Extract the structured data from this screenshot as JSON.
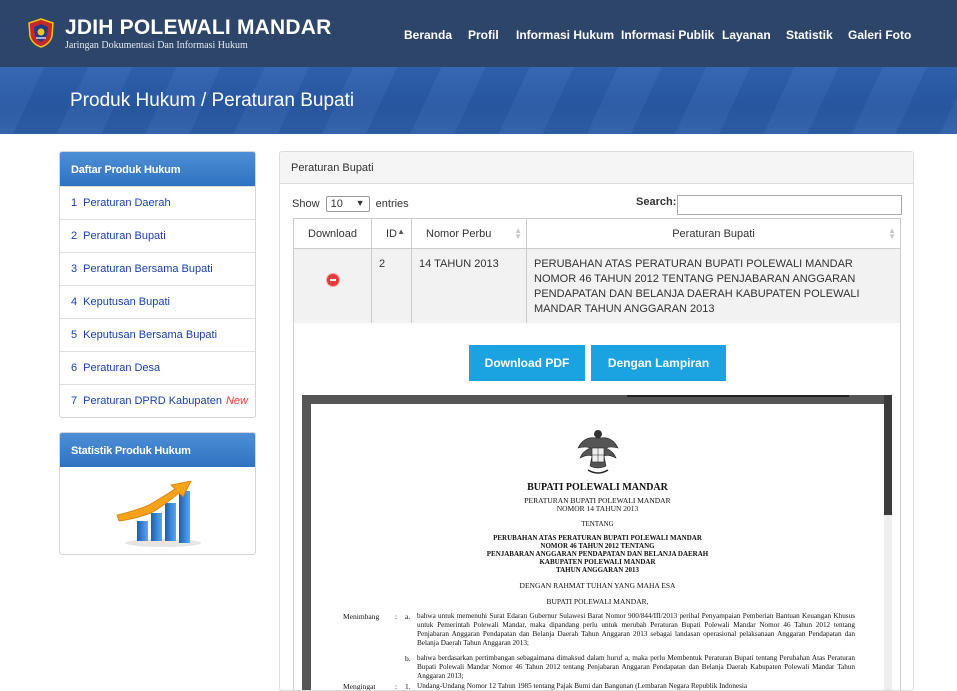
{
  "brand": {
    "title": "JDIH POLEWALI MANDAR",
    "subtitle": "Jaringan Dokumentasi Dan Informasi Hukum",
    "logo_icon": "regency-crest-icon"
  },
  "nav": [
    "Beranda",
    "Profil",
    "Informasi Hukum",
    "Informasi Publik",
    "Layanan",
    "Statistik",
    "Galeri Foto"
  ],
  "banner": {
    "title": "Produk Hukum / Peraturan Bupati"
  },
  "sidebar": {
    "panel_title": "Daftar Produk Hukum",
    "items": [
      {
        "num": "1",
        "label": "Peraturan Daerah",
        "badge": ""
      },
      {
        "num": "2",
        "label": "Peraturan Bupati",
        "badge": ""
      },
      {
        "num": "3",
        "label": "Peraturan Bersama Bupati",
        "badge": ""
      },
      {
        "num": "4",
        "label": "Keputusan Bupati",
        "badge": ""
      },
      {
        "num": "5",
        "label": "Keputusan Bersama Bupati",
        "badge": ""
      },
      {
        "num": "6",
        "label": "Peraturan Desa",
        "badge": ""
      },
      {
        "num": "7",
        "label": "Peraturan DPRD Kabupaten",
        "badge": "New"
      }
    ],
    "stats_title": "Statistik Produk Hukum",
    "stats_icon": "bar-chart-growth-icon"
  },
  "main": {
    "panel_title": "Peraturan Bupati",
    "show_label": "Show",
    "show_value": "10",
    "entries_label": "entries",
    "search_label": "Search:",
    "search_value": "",
    "columns": [
      "Download",
      "ID",
      "Nomor Perbu",
      "Peraturan Bupati"
    ],
    "rows": [
      {
        "download_icon": "minus-circle-icon",
        "id": "2",
        "nomor": "14 TAHUN 2013",
        "judul": "PERUBAHAN ATAS PERATURAN BUPATI POLEWALI MANDAR NOMOR 46 TAHUN 2012 TENTANG PENJABARAN ANGGARAN PENDAPATAN DAN BELANJA DAERAH KABUPATEN POLEWALI MANDAR TAHUN ANGGARAN 2013"
      }
    ],
    "buttons": {
      "download_pdf": "Download PDF",
      "lampiran": "Dengan Lampiran"
    }
  },
  "document": {
    "emblem_icon": "garuda-emblem-icon",
    "heading": "BUPATI POLEWALI MANDAR",
    "line1": "PERATURAN BUPATI POLEWALI MANDAR",
    "line2": "NOMOR 14 TAHUN 2013",
    "tentang": "TENTANG",
    "judul1": "PERUBAHAN ATAS PERATURAN BUPATI POLEWALI MANDAR",
    "judul2": "NOMOR 46 TAHUN 2012 TENTANG",
    "judul3": "PENJABARAN ANGGARAN PENDAPATAN DAN BELANJA DAERAH",
    "judul4": "KABUPATEN POLEWALI MANDAR",
    "judul5": "TAHUN ANGGARAN 2013",
    "rahmat": "DENGAN RAHMAT TUHAN YANG MAHA ESA",
    "bupati": "BUPATI POLEWALI MANDAR,",
    "menimbang_label": "Menimbang",
    "colon": ":",
    "a_label": "a.",
    "a_text": "bahwa untuk memenuhi Surat Edaran Gubernur Sulawesi Barat Nomor 900/844/III/2013 perihal Penyampaian Pemberian Bantuan Keuangan Khusus untuk Pemerintah Polewali Mandar, maka dipandang perlu untuk merubah Peraturan Bupati Polewali Mandar Nomor 46 Tahun 2012 tentang Penjabaran Anggaran Pendapatan dan Belanja Daerah Tahun Anggaran 2013 sebagai landasan operasional pelaksanaan Anggaran Pendapatan dan Belanja Daerah Tahun Anggaran 2013;",
    "b_label": "b.",
    "b_text": "bahwa berdasarkan pertimbangan sebagaimana dimaksud dalam huruf a, maka perlu Membentuk Peraturan Bupati tentang Perubahan Atas Peraturan Bupati Polewali Mandar Nomor 46 Tahun 2012 tentang Penjabaran Anggaran Pendapatan dan Belanja Daerah Kabupaten Polewali Mandar Tahun Anggaran 2013;",
    "mengingat_label": "Mengingat",
    "m1_label": "1.",
    "m1_text": "Undang-Undang Nomor  12 Tahun 1985 tentang Pajak Bumi dan Bangunan  (Lembaran Negara Republik Indonesia"
  }
}
